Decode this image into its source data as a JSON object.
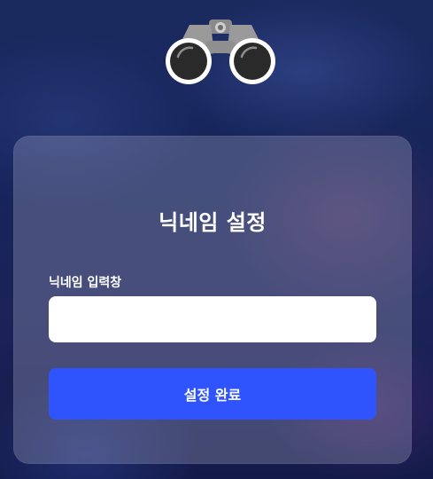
{
  "logo": {
    "icon": "binoculars-icon"
  },
  "form": {
    "title": "닉네임 설정",
    "field_label": "닉네임 입력창",
    "input_value": "",
    "input_placeholder": "",
    "submit_label": "설정 완료"
  },
  "colors": {
    "accent": "#2f54fe",
    "card": "rgba(190,190,215,0.28)",
    "background": "#16245a"
  }
}
